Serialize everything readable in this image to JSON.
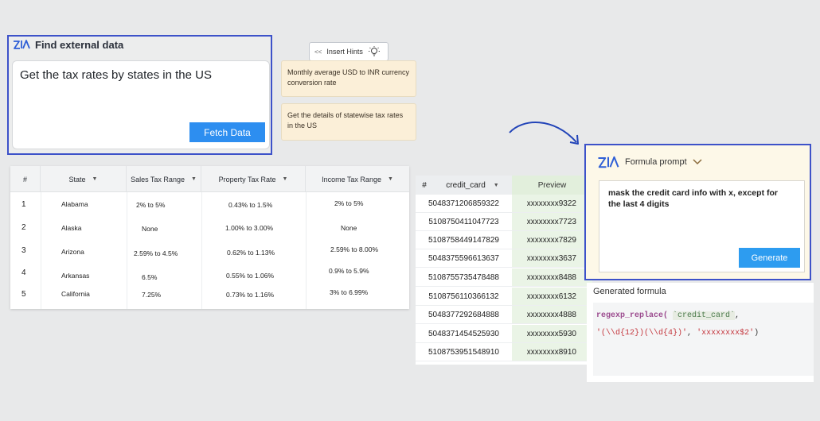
{
  "find_external": {
    "title": "Find external data",
    "query": "Get the tax rates by states in the US",
    "fetch_label": "Fetch Data"
  },
  "hints": {
    "button_label": "Insert Hints",
    "button_chevron": "<<",
    "items": [
      "Monthly average USD to INR currency conversion rate",
      "Get the details of statewise tax rates in the US"
    ]
  },
  "tax_table": {
    "headers": [
      "#",
      "State",
      "Sales Tax Range",
      "Property Tax Rate",
      "Income Tax Range"
    ],
    "rows": [
      [
        "1",
        "Alabama",
        "2% to 5%",
        "0.43% to 1.5%",
        "2% to 5%"
      ],
      [
        "2",
        "Alaska",
        "None",
        "1.00% to 3.00%",
        "None"
      ],
      [
        "3",
        "Arizona",
        "2.59% to 4.5%",
        "0.62% to 1.13%",
        "2.59% to 8.00%"
      ],
      [
        "4",
        "Arkansas",
        "6.5%",
        "0.55% to 1.06%",
        "0.9% to 5.9%"
      ],
      [
        "5",
        "California",
        "7.25%",
        "0.73% to 1.16%",
        "3% to 6.99%"
      ]
    ]
  },
  "cc_table": {
    "hash": "#",
    "col_card": "credit_card",
    "col_preview": "Preview",
    "rows": [
      [
        "5048371206859322",
        "xxxxxxxx9322"
      ],
      [
        "5108750411047723",
        "xxxxxxxx7723"
      ],
      [
        "5108758449147829",
        "xxxxxxxx7829"
      ],
      [
        "5048375596613637",
        "xxxxxxxx3637"
      ],
      [
        "5108755735478488",
        "xxxxxxxx8488"
      ],
      [
        "5108756110366132",
        "xxxxxxxx6132"
      ],
      [
        "5048377292684888",
        "xxxxxxxx4888"
      ],
      [
        "5048371454525930",
        "xxxxxxxx5930"
      ],
      [
        "5108753951548910",
        "xxxxxxxx8910"
      ]
    ]
  },
  "formula_prompt": {
    "title": "Formula prompt",
    "prompt_text": "mask the credit card info with x, except for the last 4 digits",
    "generate_label": "Generate"
  },
  "generated_formula": {
    "title": "Generated formula",
    "fn": "regexp_replace(",
    "arg1": "`credit_card`",
    "comma1": ",",
    "arg2": "'(\\\\d{12})(\\\\d{4})'",
    "comma2": ",",
    "arg3": "'xxxxxxxx$2'",
    "close": ")"
  },
  "colors": {
    "accent_border": "#3d52c9",
    "button_blue": "#2d8ef0",
    "hint_bg": "#fbefd8",
    "preview_bg": "#eaf4e6"
  }
}
